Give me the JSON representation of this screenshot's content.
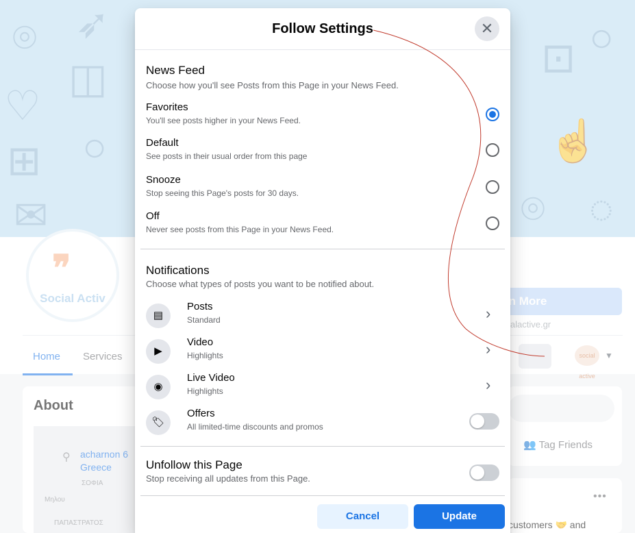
{
  "background": {
    "learn_more": "rn More",
    "site": "ialactive.gr",
    "logo_text": "Social Activ",
    "tabs": {
      "home": "Home",
      "services": "Services"
    },
    "about_title": "About",
    "address_line1": "acharnon 6",
    "address_line2": "Greece",
    "map_label1": "ΣΟΦΙΑ",
    "map_label2": "Μηλου",
    "map_label3": "ΠΑΠΑΣΤΡΑΤΟΣ",
    "tag_friends": "Tag Friends",
    "more_dots": "•••",
    "customers_text": "customers 🤝 and",
    "avatar_text": "social active"
  },
  "modal": {
    "title": "Follow Settings",
    "close_icon": "close-icon",
    "news_feed": {
      "title": "News Feed",
      "subtitle": "Choose how you'll see Posts from this Page in your News Feed.",
      "options": [
        {
          "label": "Favorites",
          "sub": "You'll see posts higher in your News Feed.",
          "selected": true
        },
        {
          "label": "Default",
          "sub": "See posts in their usual order from this page",
          "selected": false
        },
        {
          "label": "Snooze",
          "sub": "Stop seeing this Page's posts for 30 days.",
          "selected": false
        },
        {
          "label": "Off",
          "sub": "Never see posts from this Page in your News Feed.",
          "selected": false
        }
      ]
    },
    "notifications": {
      "title": "Notifications",
      "subtitle": "Choose what types of posts you want to be notified about.",
      "items": [
        {
          "label": "Posts",
          "sub": "Standard",
          "icon": "posts-icon",
          "control": "chevron"
        },
        {
          "label": "Video",
          "sub": "Highlights",
          "icon": "video-icon",
          "control": "chevron"
        },
        {
          "label": "Live Video",
          "sub": "Highlights",
          "icon": "live-video-icon",
          "control": "chevron"
        },
        {
          "label": "Offers",
          "sub": "All limited-time discounts and promos",
          "icon": "offers-icon",
          "control": "toggle",
          "on": false
        }
      ]
    },
    "unfollow": {
      "title": "Unfollow this Page",
      "subtitle": "Stop receiving all updates from this Page.",
      "on": false
    },
    "buttons": {
      "cancel": "Cancel",
      "update": "Update"
    }
  },
  "colors": {
    "accent": "#1b74e4",
    "cover": "#bcdcf0"
  }
}
